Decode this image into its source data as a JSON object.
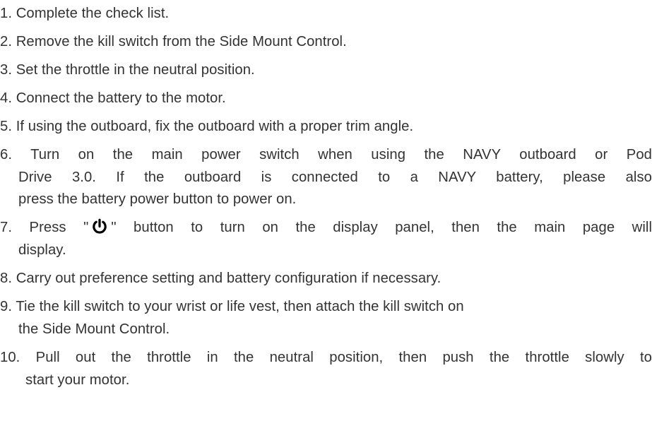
{
  "steps": [
    {
      "number": "1.",
      "lines": [
        "Complete the check list."
      ]
    },
    {
      "number": "2.",
      "lines": [
        "Remove the kill switch from the Side Mount Control."
      ]
    },
    {
      "number": "3.",
      "lines": [
        "Set the throttle in the neutral position."
      ]
    },
    {
      "number": "4.",
      "lines": [
        "Connect the battery to the motor."
      ]
    },
    {
      "number": "5.",
      "lines": [
        "If using the outboard, fix the outboard with a proper trim angle."
      ]
    },
    {
      "number": "6.",
      "lines": [
        "Turn on the main power switch when using the NAVY outboard or Pod",
        "Drive 3.0. If the outboard is connected to a NAVY battery, please also",
        "press the battery power button to power on."
      ]
    },
    {
      "number": "7.",
      "lines": [
        "Press \"",
        "\" button to turn on the display panel, then the main page will",
        "display."
      ]
    },
    {
      "number": "8.",
      "lines": [
        "Carry out preference setting and battery configuration if necessary."
      ]
    },
    {
      "number": "9.",
      "lines": [
        "Tie the kill switch to your wrist or life vest, then attach the kill switch on",
        "the Side Mount Control."
      ]
    },
    {
      "number": "10.",
      "lines": [
        "Pull out the throttle in the neutral position, then push the throttle slowly to",
        "start your motor."
      ]
    }
  ],
  "icons": {
    "power": "power-icon"
  }
}
